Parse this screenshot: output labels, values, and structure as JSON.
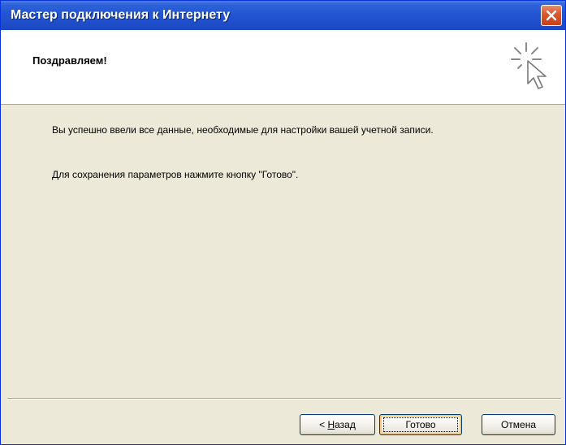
{
  "window": {
    "title": "Мастер подключения к Интернету"
  },
  "header": {
    "title": "Поздравляем!",
    "icon": "wizard-cursor-sparkle-icon"
  },
  "body": {
    "line1": "Вы успешно ввели все данные, необходимые для настройки вашей учетной записи.",
    "line2": "Для сохранения параметров нажмите кнопку \"Готово\"."
  },
  "buttons": {
    "back_arrow": "< ",
    "back_mnemonic": "Н",
    "back_rest": "азад",
    "finish": "Готово",
    "cancel": "Отмена"
  },
  "colors": {
    "titlebar": "#2457d4",
    "close": "#d9572f",
    "dialog_bg": "#ece9d8"
  }
}
